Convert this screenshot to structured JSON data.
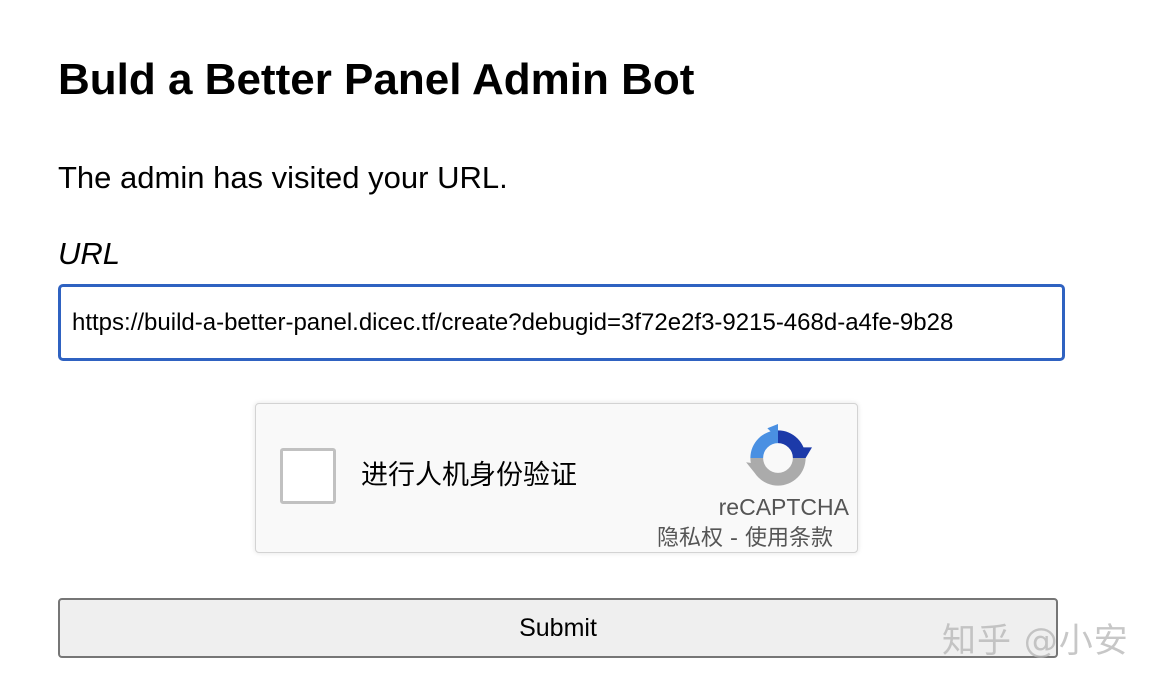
{
  "page": {
    "title": "Buld a Better Panel Admin Bot",
    "status": "The admin has visited your URL."
  },
  "form": {
    "url_label": "URL",
    "url_value": "https://build-a-better-panel.dicec.tf/create?debugid=3f72e2f3-9215-468d-a4fe-9b28",
    "submit_label": "Submit"
  },
  "recaptcha": {
    "checkbox_label": "进行人机身份验证",
    "brand": "reCAPTCHA",
    "privacy_label": "隐私权",
    "separator": " - ",
    "terms_label": "使用条款",
    "logo_icon": "recaptcha-logo-icon",
    "colors": {
      "blue": "#1c3aa9",
      "light_blue": "#4a90e2",
      "gray": "#ababab"
    }
  },
  "watermark": {
    "text": "知乎 @小安"
  },
  "colors": {
    "input_focus_border": "#2f62c1",
    "button_bg": "#efefef",
    "button_border": "#767676"
  }
}
